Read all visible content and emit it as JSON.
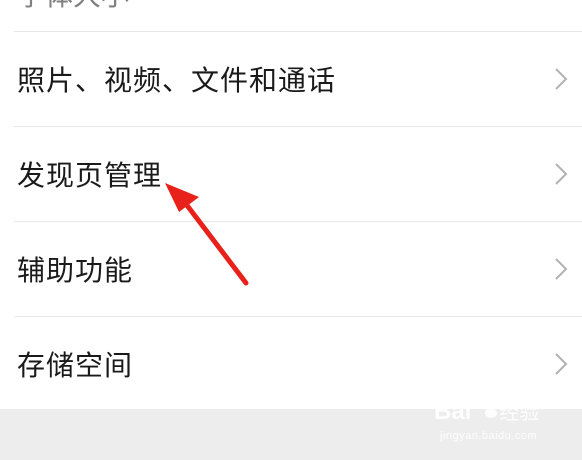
{
  "settings_list": {
    "cut_off_item": "字体大小",
    "items": [
      {
        "label": "照片、视频、文件和通话"
      },
      {
        "label": "发现页管理"
      },
      {
        "label": "辅助功能"
      },
      {
        "label": "存储空间"
      }
    ]
  },
  "annotation": {
    "arrow_color": "#e8221b",
    "points_to": "发现页管理"
  },
  "watermark": {
    "brand": "Bai",
    "brand_suffix": "经验",
    "url": "jingyan.baidu.com"
  },
  "colors": {
    "list_background": "#ffffff",
    "page_background": "#ededed",
    "text": "#1a1a1a",
    "chevron": "#b2b2b2",
    "divider": "#e8e8e8"
  }
}
